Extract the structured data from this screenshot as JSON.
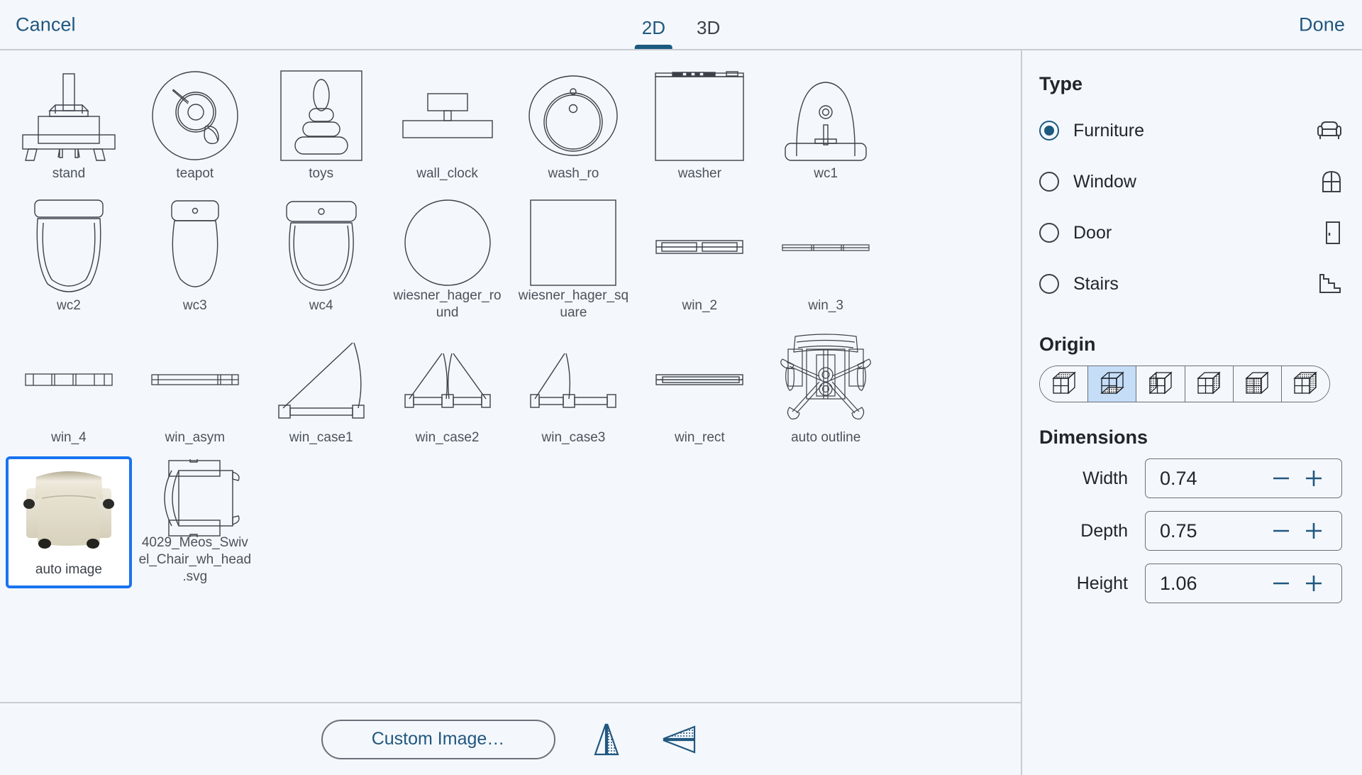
{
  "header": {
    "cancel_label": "Cancel",
    "done_label": "Done",
    "tabs": [
      {
        "label": "2D",
        "active": true
      },
      {
        "label": "3D",
        "active": false
      }
    ]
  },
  "gallery": {
    "items": [
      {
        "label": "stand",
        "icon": "stand",
        "selected": false
      },
      {
        "label": "teapot",
        "icon": "teapot",
        "selected": false
      },
      {
        "label": "toys",
        "icon": "toys",
        "selected": false
      },
      {
        "label": "wall_clock",
        "icon": "wall_clock",
        "selected": false
      },
      {
        "label": "wash_ro",
        "icon": "wash_ro",
        "selected": false
      },
      {
        "label": "washer",
        "icon": "washer",
        "selected": false
      },
      {
        "label": "wc1",
        "icon": "wc1",
        "selected": false
      },
      {
        "label": "",
        "icon": "empty",
        "selected": false
      },
      {
        "label": "wc2",
        "icon": "wc2",
        "selected": false
      },
      {
        "label": "wc3",
        "icon": "wc3",
        "selected": false
      },
      {
        "label": "wc4",
        "icon": "wc4",
        "selected": false
      },
      {
        "label": "wiesner_hager_round",
        "icon": "circle",
        "selected": false
      },
      {
        "label": "wiesner_hager_square",
        "icon": "square",
        "selected": false
      },
      {
        "label": "win_2",
        "icon": "win_2",
        "selected": false
      },
      {
        "label": "win_3",
        "icon": "win_3",
        "selected": false
      },
      {
        "label": "",
        "icon": "empty",
        "selected": false
      },
      {
        "label": "win_4",
        "icon": "win_4",
        "selected": false
      },
      {
        "label": "win_asym",
        "icon": "win_asym",
        "selected": false
      },
      {
        "label": "win_case1",
        "icon": "win_case1",
        "selected": false
      },
      {
        "label": "win_case2",
        "icon": "win_case2",
        "selected": false
      },
      {
        "label": "win_case3",
        "icon": "win_case3",
        "selected": false
      },
      {
        "label": "win_rect",
        "icon": "win_rect",
        "selected": false
      },
      {
        "label": "auto outline",
        "icon": "auto_outline",
        "selected": false
      },
      {
        "label": "",
        "icon": "empty",
        "selected": false
      },
      {
        "label": "auto image",
        "icon": "auto_image",
        "selected": true
      },
      {
        "label": "4029_Meos_Swivel_Chair_wh_head.svg",
        "icon": "swivel_chair",
        "selected": false
      }
    ]
  },
  "bottom_toolbar": {
    "custom_image_label": "Custom Image…",
    "flip_horizontal_name": "flip-horizontal-icon",
    "flip_vertical_name": "flip-vertical-icon"
  },
  "sidebar": {
    "type": {
      "title": "Type",
      "options": [
        {
          "label": "Furniture",
          "icon": "armchair-icon",
          "selected": true
        },
        {
          "label": "Window",
          "icon": "window-icon",
          "selected": false
        },
        {
          "label": "Door",
          "icon": "door-icon",
          "selected": false
        },
        {
          "label": "Stairs",
          "icon": "stairs-icon",
          "selected": false
        }
      ]
    },
    "origin": {
      "title": "Origin",
      "options": [
        {
          "name": "origin-top-face",
          "selected": false
        },
        {
          "name": "origin-center",
          "selected": true
        },
        {
          "name": "origin-left-face",
          "selected": false
        },
        {
          "name": "origin-right-face",
          "selected": false
        },
        {
          "name": "origin-front-face",
          "selected": false
        },
        {
          "name": "origin-back-face",
          "selected": false
        }
      ]
    },
    "dimensions": {
      "title": "Dimensions",
      "fields": [
        {
          "label": "Width",
          "value": "0.74"
        },
        {
          "label": "Depth",
          "value": "0.75"
        },
        {
          "label": "Height",
          "value": "1.06"
        }
      ],
      "decrement_label": "−",
      "increment_label": "+"
    }
  },
  "colors": {
    "background": "#f4f8fc",
    "accent_blue": "#22577f",
    "selection_blue": "#1a73f0",
    "origin_active": "#c5ddf7",
    "border": "#c8cdd4",
    "line": "#3c4149"
  }
}
